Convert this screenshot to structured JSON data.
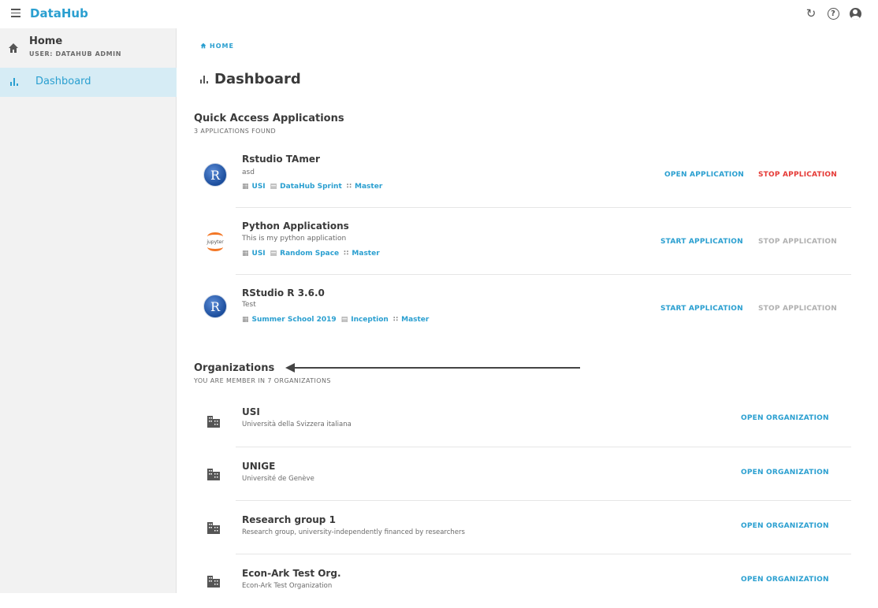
{
  "topbar": {
    "brand": "DataHub"
  },
  "sidebar": {
    "home_title": "Home",
    "home_user": "USER: DATAHUB ADMIN",
    "dashboard_label": "Dashboard"
  },
  "breadcrumb": {
    "label": "HOME"
  },
  "page": {
    "title": "Dashboard"
  },
  "quick_access": {
    "title": "Quick Access Applications",
    "subtitle": "3 APPLICATIONS FOUND",
    "apps": [
      {
        "name": "Rstudio TAmer",
        "desc": "asd",
        "org": "USI",
        "space": "DataHub Sprint",
        "group": "Master",
        "primary": "OPEN APPLICATION",
        "stop": "STOP APPLICATION",
        "logo": "r-icon"
      },
      {
        "name": "Python Applications",
        "desc": "This is my python application",
        "org": "USI",
        "space": "Random Space",
        "group": "Master",
        "primary": "START APPLICATION",
        "stop": "STOP APPLICATION",
        "logo": "jupyter-icon"
      },
      {
        "name": "RStudio R 3.6.0",
        "desc": "Test",
        "org": "Summer School 2019",
        "space": "Inception",
        "group": "Master",
        "primary": "START APPLICATION",
        "stop": "STOP APPLICATION",
        "logo": "r-icon"
      }
    ]
  },
  "organizations": {
    "title": "Organizations",
    "subtitle": "YOU ARE MEMBER IN 7 ORGANIZATIONS",
    "items": [
      {
        "name": "USI",
        "desc": "Università della Svizzera italiana",
        "action": "OPEN ORGANIZATION"
      },
      {
        "name": "UNIGE",
        "desc": "Université de Genève",
        "action": "OPEN ORGANIZATION"
      },
      {
        "name": "Research group 1",
        "desc": "Research group, university-independently financed by researchers",
        "action": "OPEN ORGANIZATION"
      },
      {
        "name": "Econ-Ark Test Org.",
        "desc": "Econ-Ark Test Organization",
        "action": "OPEN ORGANIZATION"
      }
    ]
  },
  "colors": {
    "accent": "#2a9fd0",
    "danger": "#e53935",
    "disabled": "#b0b0b0",
    "sidebar_bg": "#f2f2f2",
    "sidebar_active": "#d6ecf5"
  }
}
